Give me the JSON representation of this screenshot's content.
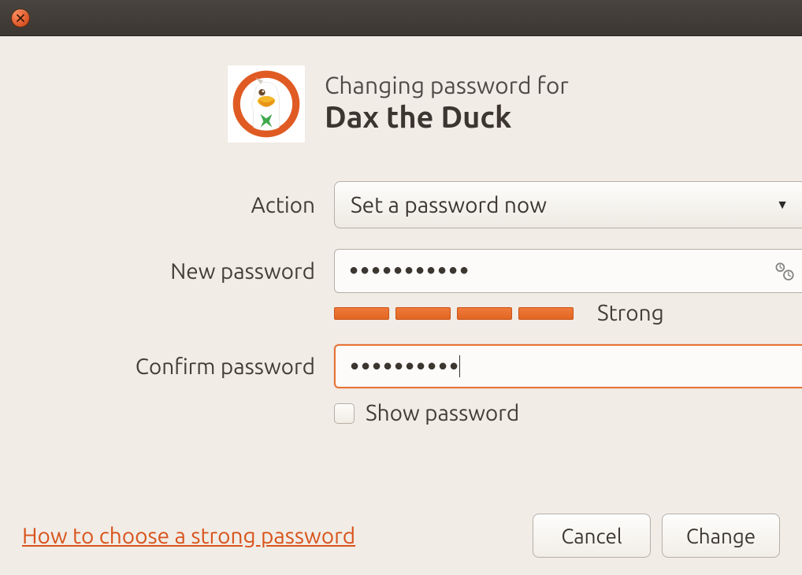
{
  "header": {
    "subtitle": "Changing password for",
    "username": "Dax the Duck"
  },
  "labels": {
    "action": "Action",
    "new_password": "New password",
    "confirm_password": "Confirm password",
    "show_password": "Show password"
  },
  "action_combo": {
    "selected": "Set a password now"
  },
  "fields": {
    "new_password_mask": "●●●●●●●●●●●",
    "confirm_password_mask": "●●●●●●●●●●"
  },
  "strength": {
    "text": "Strong",
    "segments_filled": 4,
    "segments_total": 4,
    "color": "#e66a2a"
  },
  "show_password_checked": false,
  "help_link": "How to choose a strong password",
  "buttons": {
    "cancel": "Cancel",
    "change": "Change"
  }
}
